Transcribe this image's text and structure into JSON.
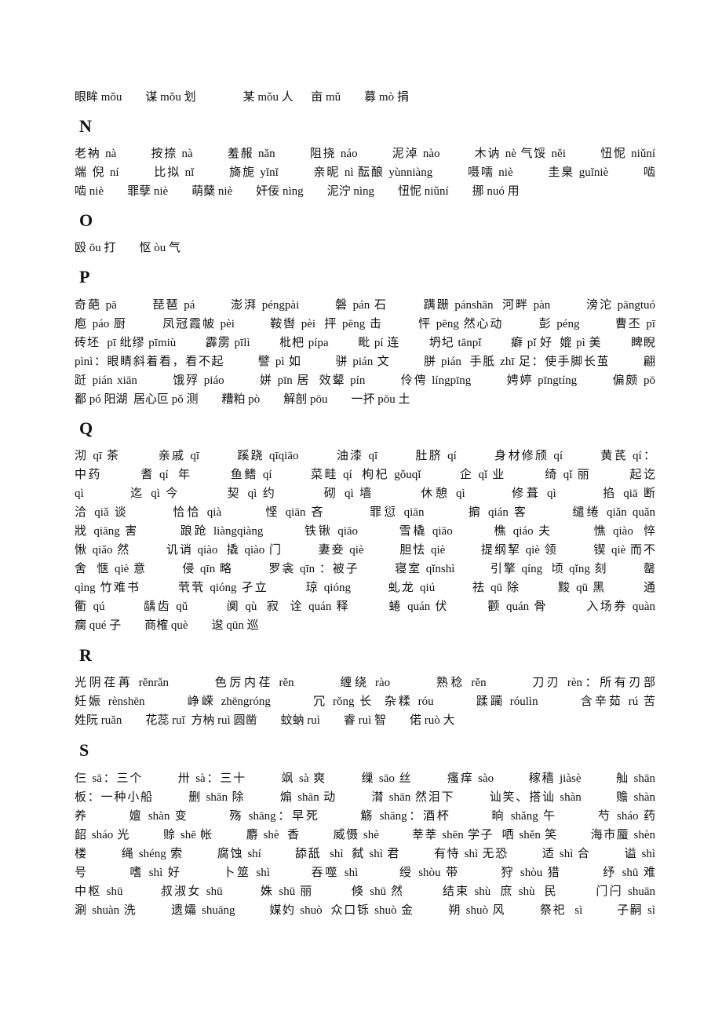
{
  "sections": [
    {
      "letter": "",
      "lines": [
        "眼眸 mǒu        谋 mǒu 划                某 mǒu 人      亩 mǔ        募 mò 捐"
      ]
    },
    {
      "letter": "N",
      "lines": [
        "老衲 nà        按捺 nà        羞赧 nǎn        阻挠 náo        泥淖 nào        木讷 nè 气馁 něi        忸怩 niǔní",
        "端 倪 ní        比拟 nǐ        旖旎 yǐnǐ        亲昵 nì 酝酿 yùnniàng        嗫嚅 niè        圭臬 guǐniè        啮",
        "啮 niè        罪孽 niè        萌蘖 niè        奸佞 nìng        泥泞 nìng        忸怩 niǔní        挪 nuó 用"
      ]
    },
    {
      "letter": "O",
      "lines": [
        "殴 ōu 打        怄 òu 气"
      ]
    },
    {
      "letter": "P",
      "lines": [
        "奇葩 pā        琵琶 pá        澎湃 péngpài        磐 pán 石        蹒跚 pánshān  河畔 pàn        滂沱 pāngtuó",
        "庖 páo 厨        凤冠霞帔 pèi        鞍辔 pèi  抨 pēng 击        怦 pēng 然心动        彭 péng        曹丕 pī",
        "砖坯  pī 纰缪 pīmiù        霹雳 pīlì        枇杷 pípa        毗 pí 连        坍圮 tānpǐ        癖 pǐ 好  媲 pì 美        睥睨",
        "pìnì：眼睛斜着看，看不起        譬 pì 如        骈 pián 文        胼 pián  手胝 zhī 足：使手脚长茧        翩",
        "跹 pián xiān        饿殍 piáo        姘 pīn 居  效颦 pín        伶俜 língpīng        娉婷 pīngtíng        偏颇 pō",
        "鄱 pó 阳湖  居心叵 pǒ 测        糟粕 pò        解剖 pōu        一抔 pōu 土"
      ]
    },
    {
      "letter": "Q",
      "lines": [
        "沏 qī 茶        亲戚 qī        蹊跷 qīqiāo        油漆 qī        肚脐 qí        身材修颀 qí        黄芪 qí：",
        "中药        耆 qí  年        鱼鳍 qí        菜畦 qí  枸杞 gǒuqǐ        企 qǐ 业        绮 qǐ 丽        起讫",
        "qì        迄 qì 今        契 qì 约        砌 qì 墙        休憩 qì        修葺 qì        掐 qiā 断",
        "洽 qiǎ 谈        恰恰 qià        悭 qiān 吝        罪愆 qiān        掮 qián 客        缱绻 qiǎn quǎn",
        "戕 qiāng 害        踉跄 liàngqiàng        铁锹 qiāo        雪橇 qiāo        樵 qiáo 夫        憔 qiào  悴",
        "愀 qiǎo 然        讥诮 qiào  撬 qiào 门        妻妾 qiè        胆怯 qiè        提纲挈 qiè 领        锲 qiè 而不",
        "舍  惬 qiè 意        侵 qīn 略        罗衾 qīn ：被子        寝室 qǐnshì        引擎 qíng  顷 qǐng 刻        罄",
        "qìng 竹难书        茕茕 qióng 孑立        琼 qióng        虬龙 qiú        祛 qū 除        黢 qū 黑        通",
        "衢 qú        龋齿 qǔ        阒 qù  寂  诠 quán 释        蜷 quán 伏        颧 quán 骨        入场券 quàn",
        "瘸 qué 子        商榷 què        逡 qūn 巡"
      ]
    },
    {
      "letter": "R",
      "lines": [
        "光阴荏苒 rěnrǎn        色厉内荏 rěn        缠绕 rào        熟稔 rěn        刀刃 rèn：所有刃部",
        "妊娠 rènshēn        峥嵘 zhēngróng        冗 rǒng 长  杂糅 róu        蹂躏 róulìn        含辛茹 rú 苦",
        "姓阮 ruǎn        花蕊 ruǐ  方枘 ruì 圆凿        蚊蚋 ruì        睿 ruì 智        偌 ruò 大"
      ]
    },
    {
      "letter": "S",
      "lines": [
        "仨 sā：三个        卅 sà：三十        飒 sà 爽        缫 sāo 丝        瘙痒 sào        稼穑 jiàsè        舢 shān",
        "板：一种小船        删 shān 除        煽 shān 动        潸 shān 然泪下        讪笑、搭讪 shàn        赡 shàn",
        "养        嬗 shàn 变        殇 shāng：早死        觞 shāng：酒杯        晌 shǎng 午        芍 sháo 药",
        "韶 sháo 光        赊 shē 帐        麝 shè  香        威慑 shè        莘莘 shēn 学子  哂 shěn 笑        海市蜃 shèn",
        "楼        绳 shéng 索        腐蚀 shí        舔舐  shì  弑 shì 君        有恃 shì 无恐        适 shì 合        谥 shì",
        "号        嗜 shì 好        卜筮 shì        吞噬 shì        绶 shòu 带        狩 shòu 猎        纾 shū 难",
        "中枢 shū        叔淑女 shū        姝 shū 丽        倏 shū 然        结束 shù  庶 shù  民        门闩 shuān",
        "涮 shuàn 洗        遗孀 shuāng        媒妁 shuò  众口铄 shuò 金        朔 shuò 风        祭祀  sì        子嗣 sì"
      ]
    }
  ]
}
